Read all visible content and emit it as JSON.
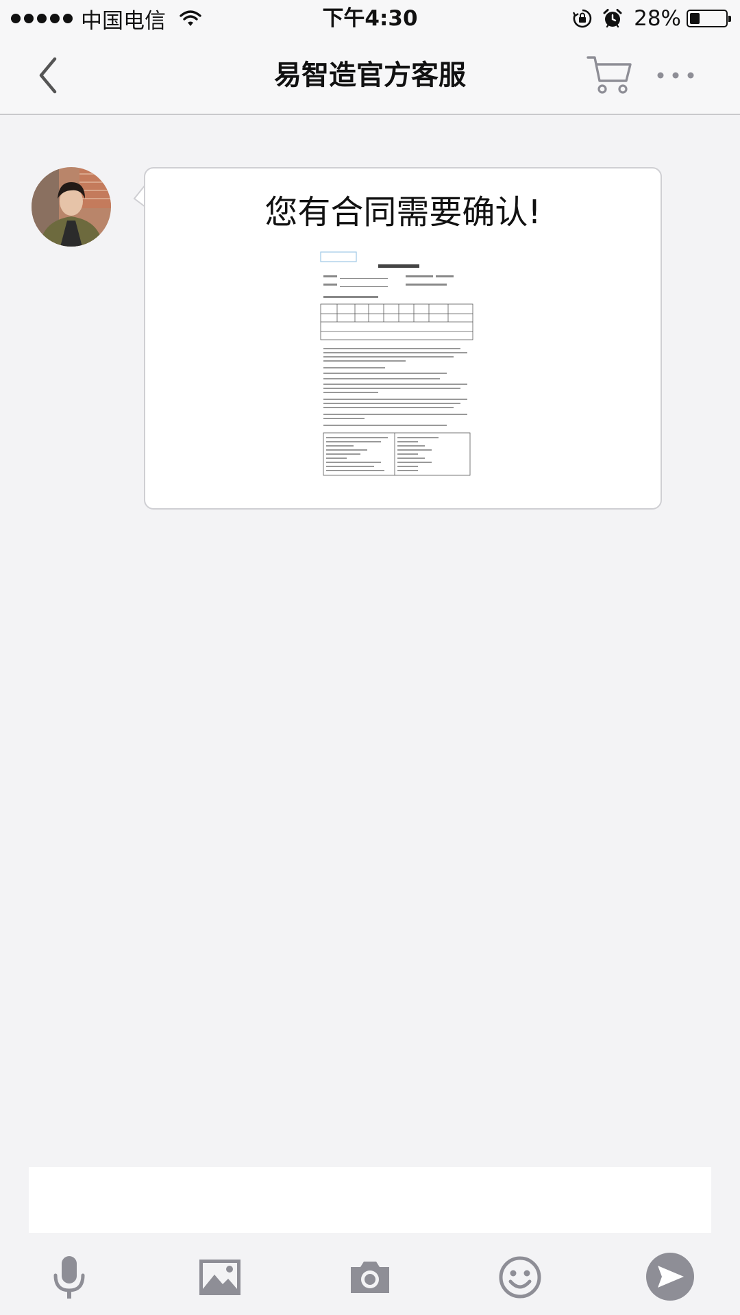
{
  "status_bar": {
    "carrier": "中国电信",
    "time": "下午4:30",
    "battery_percent": "28%",
    "battery_level": 0.28,
    "icons": [
      "signal-dots-icon",
      "wifi-icon",
      "rotation-lock-icon",
      "alarm-icon",
      "battery-icon"
    ]
  },
  "nav": {
    "title": "易智造官方客服",
    "icons": [
      "back-chevron-icon",
      "cart-icon",
      "more-icon"
    ]
  },
  "messages": [
    {
      "sender": "agent",
      "avatar": "avatar-photo",
      "text": "您有合同需要确认!",
      "attachment_icon": "contract-document-icon"
    }
  ],
  "input": {
    "value": "",
    "placeholder": ""
  },
  "toolbar": {
    "icons": [
      "microphone-icon",
      "image-icon",
      "camera-icon",
      "emoji-icon",
      "send-icon"
    ]
  },
  "colors": {
    "background": "#f3f3f5",
    "bar": "#f7f7f8",
    "icon_gray": "#8e8e96",
    "send_button": "#8e8e96"
  }
}
